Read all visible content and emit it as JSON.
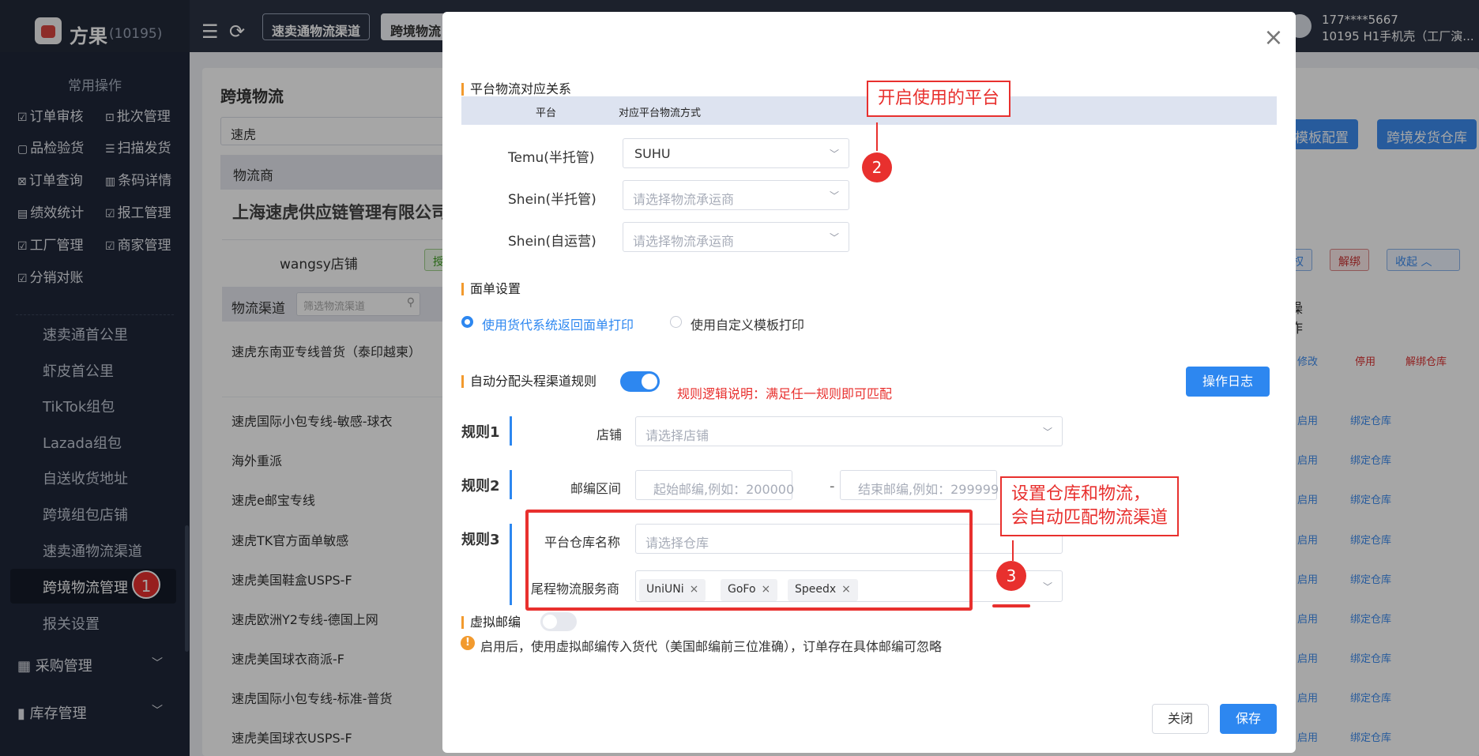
{
  "header": {
    "brand": "方果",
    "brand_id": "(10195)",
    "tabs": [
      "速卖通物流渠道",
      "跨境物流"
    ],
    "user_phone": "177****5667",
    "user_company": "10195 H1手机壳（工厂演..."
  },
  "sidebar": {
    "common_title": "常用操作",
    "quick_ops": [
      "订单审核",
      "批次管理",
      "品检验货",
      "扫描发货",
      "订单查询",
      "条码详情",
      "绩效统计",
      "报工管理",
      "工厂管理",
      "商家管理",
      "分销对账"
    ],
    "sub_items": [
      "速卖通首公里",
      "虾皮首公里",
      "TikTok组包",
      "Lazada组包",
      "自送收货地址",
      "跨境组包店铺",
      "速卖通物流渠道",
      "跨境物流管理",
      "报关设置"
    ],
    "groups": [
      "采购管理",
      "库存管理"
    ],
    "active_badge": "1"
  },
  "background": {
    "page_title": "跨境物流",
    "search_value": "速虎",
    "provider_header": "物流商",
    "company": "上海速虎供应链管理有限公司",
    "store": "wangsy店铺",
    "store_tag": "授",
    "btn_template": "模板配置",
    "btn_warehouse": "跨境发货仓库",
    "btn_auth": "权",
    "btn_unbind": "解绑",
    "btn_collapse": "收起",
    "channel_header": "物流渠道",
    "channel_search_ph": "筛选物流渠道",
    "op_header": "操作",
    "channels": [
      "速虎东南亚专线普货（泰印越柬）",
      "速虎国际小包专线-敏感-球衣",
      "海外重派",
      "速虎e邮宝专线",
      "速虎TK官方面单敏感",
      "速虎美国鞋盒USPS-F",
      "速虎欧洲Y2专线-德国上网",
      "速虎美国球衣商派-F",
      "速虎国际小包专线-标准-普货",
      "速虎美国球衣USPS-F"
    ],
    "first_row_actions": [
      "修改",
      "停用",
      "解绑仓库"
    ],
    "row_actions": [
      "启用",
      "绑定仓库"
    ]
  },
  "modal": {
    "section_mapping": "平台物流对应关系",
    "col_platform": "平台",
    "col_method": "对应平台物流方式",
    "platforms": [
      {
        "name": "Temu(半托管)",
        "value": "SUHU",
        "placeholder": ""
      },
      {
        "name": "Shein(半托管)",
        "value": "",
        "placeholder": "请选择物流承运商"
      },
      {
        "name": "Shein(自运营)",
        "value": "",
        "placeholder": "请选择物流承运商"
      }
    ],
    "section_label": "面单设置",
    "radio_system": "使用货代系统返回面单打印",
    "radio_custom": "使用自定义模板打印",
    "radio_selected": "使用货代系统返回面单打印",
    "section_rules": "自动分配头程渠道规则",
    "rules_toggle": "on",
    "rules_note": "规则逻辑说明：满足任一规则即可匹配",
    "btn_log": "操作日志",
    "rule1": "规则1",
    "rule1_field": "店铺",
    "rule1_ph": "请选择店铺",
    "rule2": "规则2",
    "rule2_field": "邮编区间",
    "zip_start_ph": "起始邮编,例如：200000",
    "zip_sep": "-",
    "zip_end_ph": "结束邮编,例如：299999",
    "rule3": "规则3",
    "rule3_field1": "平台仓库名称",
    "rule3_ph1": "请选择仓库",
    "rule3_field2": "尾程物流服务商",
    "carriers": [
      "UniUNi",
      "GoFo",
      "Speedx"
    ],
    "virtual_zip": "虚拟邮编",
    "virtual_toggle": "off",
    "warn": "启用后，使用虚拟邮编传入货代（美国邮编前三位准确），订单存在具体邮编可忽略",
    "btn_close": "关闭",
    "btn_save": "保存"
  },
  "annotations": {
    "callout1": "开启使用的平台",
    "callout2_line1": "设置仓库和物流，",
    "callout2_line2": "会自动匹配物流渠道",
    "badge2": "2",
    "badge3": "3",
    "accent_color": "#e8302e"
  }
}
